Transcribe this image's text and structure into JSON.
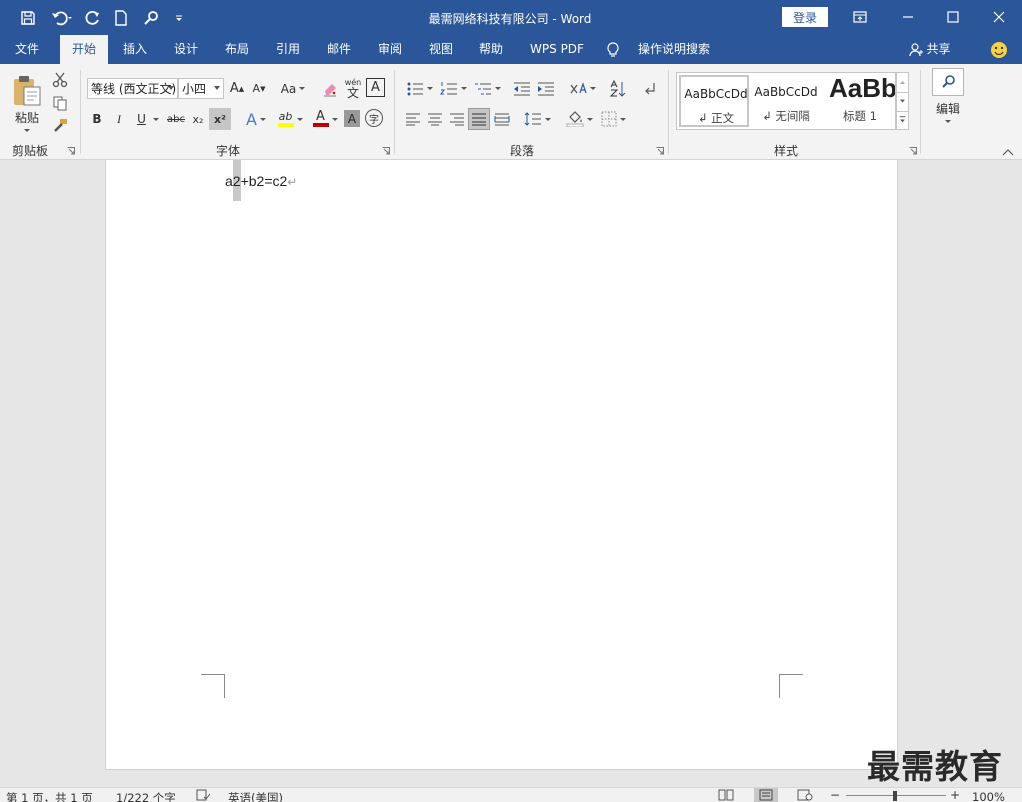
{
  "titlebar": {
    "title": "最需网络科技有限公司  -  Word",
    "login": "登录"
  },
  "tabs": [
    "文件",
    "开始",
    "插入",
    "设计",
    "布局",
    "引用",
    "邮件",
    "审阅",
    "视图",
    "帮助",
    "WPS PDF"
  ],
  "tell_me": "操作说明搜索",
  "share": "共享",
  "ribbon": {
    "clipboard": {
      "paste": "粘贴",
      "group": "剪贴板"
    },
    "font": {
      "name": "等线 (西文正文)",
      "size": "小四",
      "grow": "A",
      "shrink": "A",
      "case": "Aa",
      "phonetic": "wén",
      "phonetic_char": "文",
      "border_char": "A",
      "bold": "B",
      "italic": "I",
      "underline": "U",
      "strike": "abc",
      "subscript": "x₂",
      "superscript": "x²",
      "effects": "A",
      "highlight": "ab",
      "color": "A",
      "shading": "A",
      "enclose": "字",
      "group": "字体"
    },
    "paragraph": {
      "group": "段落"
    },
    "styles": {
      "group": "样式",
      "items": [
        {
          "preview": "AaBbCcDd",
          "name": "↲ 正文"
        },
        {
          "preview": "AaBbCcDd",
          "name": "↲ 无间隔"
        },
        {
          "preview": "AaBb",
          "name": "标题 1"
        }
      ]
    },
    "editing": {
      "label": "编辑"
    }
  },
  "document": {
    "content": "a2+b2=c2",
    "para_mark": "↵"
  },
  "watermark": "最需教育",
  "status": {
    "page": "第 1 页，共 1 页",
    "words": "1/222 个字",
    "language": "英语(美国)",
    "zoom": "100%"
  },
  "colors": {
    "brand": "#2b579a",
    "highlight": "#ffff00",
    "font_color": "#c00000"
  }
}
